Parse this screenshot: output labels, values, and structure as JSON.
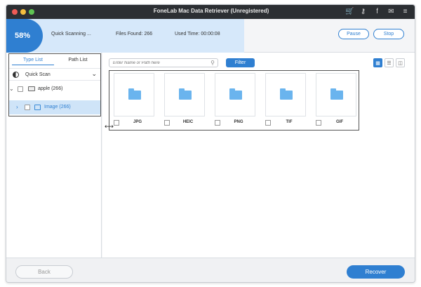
{
  "window": {
    "title": "FoneLab Mac Data Retriever (Unregistered)"
  },
  "title_icons": [
    {
      "name": "cart-icon",
      "glyph": "🛒"
    },
    {
      "name": "key-icon",
      "glyph": "⚷"
    },
    {
      "name": "facebook-icon",
      "glyph": "f"
    },
    {
      "name": "chat-icon",
      "glyph": "✉"
    },
    {
      "name": "menu-icon",
      "glyph": "≡"
    }
  ],
  "scan": {
    "percent": 58,
    "percent_label": "58%",
    "status": "Quick Scanning ...",
    "files_found": "Files Found: 266",
    "used_time": "Used Time: 00:00:08",
    "pause_label": "Pause",
    "stop_label": "Stop"
  },
  "sidebar": {
    "tabs": [
      {
        "label": "Type List",
        "active": true
      },
      {
        "label": "Path List",
        "active": false
      }
    ],
    "quick_scan_label": "Quick Scan",
    "tree": {
      "apple_label": "apple (266)",
      "image_label": "Image (266)"
    }
  },
  "toolbar": {
    "search_placeholder": "Enter Name or Path here",
    "filter_label": "Filter"
  },
  "folders": [
    {
      "label": "JPG"
    },
    {
      "label": "HEIC"
    },
    {
      "label": "PNG"
    },
    {
      "label": "TIF"
    },
    {
      "label": "GIF"
    }
  ],
  "footer": {
    "back_label": "Back",
    "recover_label": "Recover"
  },
  "colors": {
    "accent": "#2f7fd1",
    "progress_fill": "#d6e8fa",
    "titlebar": "#2c2f33",
    "folder": "#6ab4ee"
  }
}
